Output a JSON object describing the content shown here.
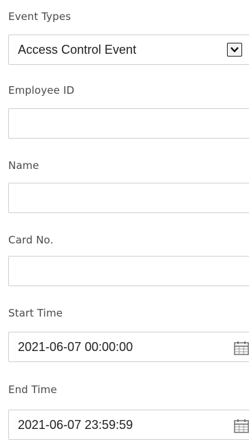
{
  "event_types": {
    "label": "Event Types",
    "selected": "Access Control Event",
    "icon": "chevron-down-icon"
  },
  "employee_id": {
    "label": "Employee ID",
    "value": ""
  },
  "name": {
    "label": "Name",
    "value": ""
  },
  "card_no": {
    "label": "Card No.",
    "value": ""
  },
  "start_time": {
    "label": "Start Time",
    "value": "2021-06-07 00:00:00",
    "icon": "calendar-icon"
  },
  "end_time": {
    "label": "End Time",
    "value": "2021-06-07 23:59:59",
    "icon": "calendar-icon"
  }
}
